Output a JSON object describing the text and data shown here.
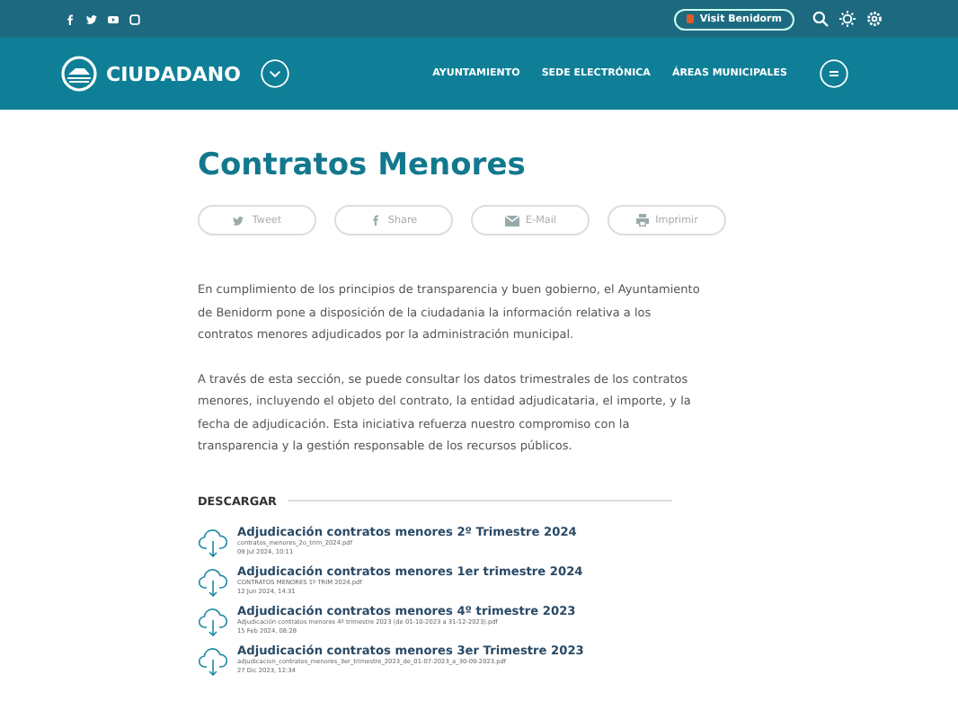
{
  "topbar": {
    "social": [
      {
        "kind": "facebook"
      },
      {
        "kind": "twitter"
      },
      {
        "kind": "youtube"
      },
      {
        "kind": "instagram"
      }
    ],
    "visit_button": "Visit Benidorm"
  },
  "nav": {
    "logo": "CIUDADANO",
    "links": [
      "AYUNTAMIENTO",
      "SEDE ELECTRÓNICA",
      "ÁREAS MUNICIPALES"
    ]
  },
  "title": "Contratos Menores",
  "share_buttons": [
    {
      "kind": "twitter",
      "label": "Tweet"
    },
    {
      "kind": "facebook",
      "label": "Share"
    },
    {
      "kind": "mail",
      "label": "E-Mail"
    },
    {
      "kind": "print",
      "label": "Imprimir"
    }
  ],
  "paragraphs": [
    "En cumplimiento de los principios de transparencia y buen gobierno, el Ayuntamiento de Benidorm pone a disposición de la ciudadania la información relativa a los contratos menores adjudicados por la administración municipal.",
    "A través de esta sección, se puede consultar los datos trimestrales de los contratos menores, incluyendo el objeto del contrato, la entidad adjudicataria, el importe, y la fecha de adjudicación. Esta iniciativa refuerza nuestro compromiso con la transparencia y la gestión responsable de los recursos públicos."
  ],
  "downloads": {
    "heading": "DESCARGAR",
    "items": [
      {
        "title": "Adjudicación contratos menores 2º Trimestre 2024",
        "file": "contratos_menores_2o_trim_2024.pdf",
        "date": "09 Jul 2024, 10:11"
      },
      {
        "title": "Adjudicación contratos menores 1er trimestre 2024",
        "file": "CONTRATOS MENORES 1º TRIM 2024.pdf",
        "date": "12 Jun 2024, 14:31"
      },
      {
        "title": "Adjudicación contratos menores 4º trimestre 2023",
        "file": "Adjudicación contratos menores 4º trimestre 2023 (de 01-10-2023 a 31-12-2023).pdf",
        "date": "15 Feb 2024, 08:28"
      },
      {
        "title": "Adjudicación contratos menores 3er Trimestre 2023",
        "file": "adjudicacion_contratos_menores_3er_trimestre_2023_de_01-07-2023_a_30-09-2023.pdf",
        "date": "27 Dic 2023, 12:34"
      }
    ]
  }
}
